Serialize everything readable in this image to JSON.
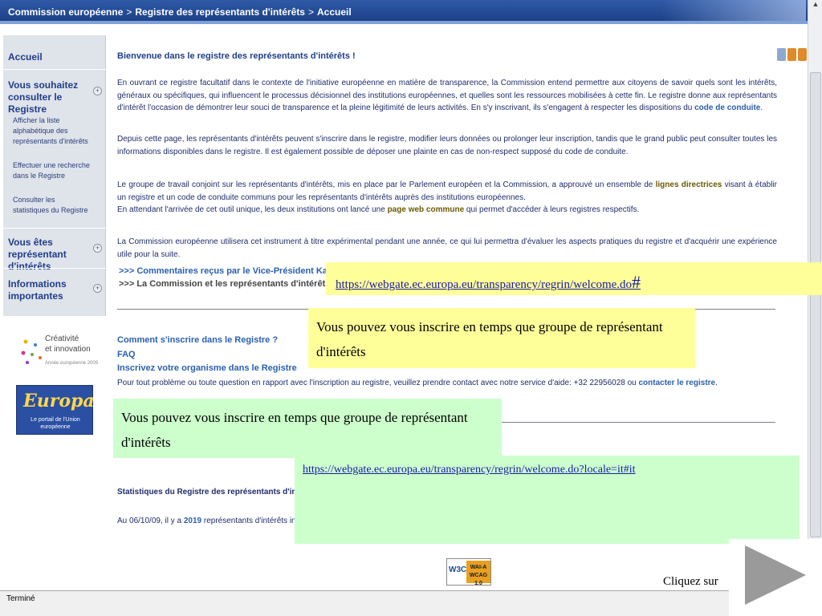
{
  "breadcrumb": [
    "Commission européenne",
    "Registre des représentants d'intérêts",
    "Accueil"
  ],
  "breadcrumb_sep": ">",
  "sidebar": {
    "accueil": "Accueil",
    "section1_title": "Vous souhaitez consulter le Registre",
    "section1_items": [
      "Afficher la liste alphabétique des représentants d'intérêts",
      "Effectuer une recherche dans le Registre",
      "Consulter les statistiques du Registre"
    ],
    "section2_title": "Vous êtes représentant d'intérêts",
    "section3_title": "Informations importantes",
    "plus_glyph": "+"
  },
  "logos": {
    "creativite_line1": "Créativité",
    "creativite_line2": "et innovation",
    "creativite_year": "Année européenne 2009",
    "europa_word": "Europa",
    "europa_sub": "Le portail de l'Union européenne"
  },
  "main": {
    "welcome": "Bienvenue dans le registre des représentants d'intérêts !",
    "p1_text": "En ouvrant ce registre facultatif dans le contexte de l'initiative européenne en matière de transparence, la Commission entend permettre aux citoyens de savoir quels sont les intérêts, généraux ou spécifiques, qui influencent le processus décisionnel des institutions européennes, et quelles sont les ressources mobilisées à cette fin. Le registre donne aux représentants d'intérêt l'occasion de démontrer leur souci de transparence et la pleine légitimité de leurs activités. En s'y inscrivant, ils s'engagent à respecter les dispositions du ",
    "p1_link": "code de conduite",
    "p1_end": ".",
    "p2": "Depuis cette page, les représentants d'intérêts peuvent s'inscrire dans le registre, modifier leurs données ou prolonger leur inscription, tandis que le grand public peut consulter toutes les informations disponibles dans le registre. Il est également possible de déposer une plainte en cas de non-respect supposé du code de conduite.",
    "p3_a": "Le groupe de travail conjoint sur les représentants d'intérêts, mis en place par le Parlement européen et la Commission, a  approuvé un ensemble de ",
    "p3_link": "lignes directrices",
    "p3_b": " visant à établir un registre et un code de conduite communs pour les représentants d'intérêts auprès des institutions européennes.",
    "p3_c": "En attendant l'arrivée de cet outil unique, les deux institutions ont lancé une ",
    "p3_link2": "page web commune",
    "p3_d": " qui permet d'accéder à leurs registres respectifs.",
    "p4": "La Commission européenne utilisera cet instrument à titre expérimental pendant une année, ce qui lui permettra d'évaluer les aspects pratiques du registre et d'acquérir une expérience utile pour la suite.",
    "link_kallas": ">>> Commentaires reçus par le Vice-Président Kallas",
    "link_commission": ">>> La Commission et les représentants d'intérêts",
    "howto_1": "Comment s'inscrire dans le Registre ?",
    "howto_2": "FAQ",
    "howto_3": "Inscrivez votre organisme dans le Registre",
    "howto_4a": "Pour tout problème ou toute question en rapport avec l'inscription au registre, veuillez prendre contact avec notre service d'aide: +32 22956028 ou ",
    "howto_4link": "contacter le registre",
    "howto_4b": ".",
    "stats_title": "Statistiques du Registre des représentants d'intérêts",
    "stats_a": "Au 06/10/09, il y a ",
    "stats_num": "2019",
    "stats_b": " représentants d'intérêts inscrits da"
  },
  "wai": {
    "w3c": "W3C",
    "badge_l1": "WAI-A",
    "badge_l2": "WCAG 1.0"
  },
  "status": "Terminé",
  "overlays": {
    "link1": "https://webgate.ec.europa.eu/transparency/regrin/welcome.do",
    "link1_hash": "#",
    "yellow_text": "Vous pouvez vous inscrire en temps que groupe de représentant d'intérêts",
    "green_text": "Vous pouvez vous inscrire en temps que groupe de représentant d'intérêts",
    "link2": "https://webgate.ec.europa.eu/transparency/regrin/welcome.do?locale=it#it",
    "cliquez": "Cliquez sur"
  },
  "colors": {
    "header": "#1c3f86",
    "link": "#2a60b0",
    "yellow_note": "#ffff99",
    "green_note": "#ccffcc"
  }
}
